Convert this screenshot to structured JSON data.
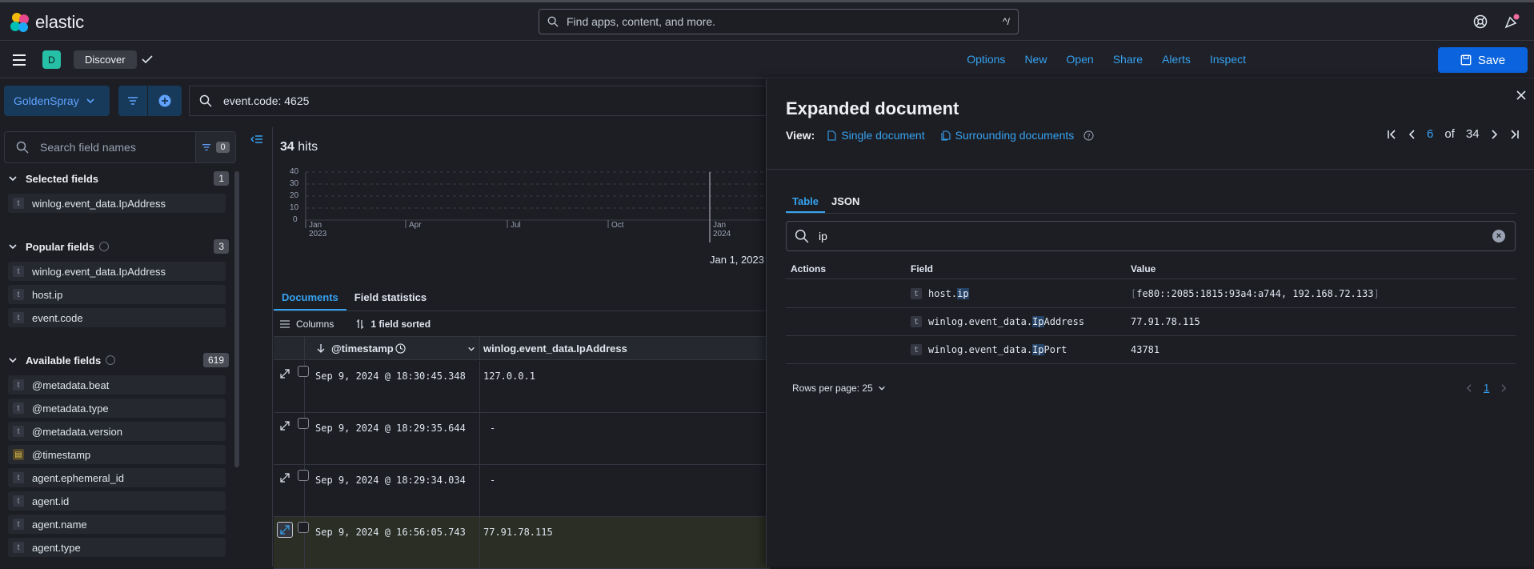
{
  "header": {
    "brand": "elastic",
    "search_placeholder": "Find apps, content, and more.",
    "search_shortcut": "^/",
    "space_initial": "D",
    "breadcrumb": "Discover",
    "links": [
      "Options",
      "New",
      "Open",
      "Share",
      "Alerts",
      "Inspect"
    ],
    "save_label": "Save"
  },
  "query": {
    "data_view": "GoldenSpray",
    "text": "event.code: 4625"
  },
  "sidebar": {
    "search_placeholder": "Search field names",
    "filter_count": "0",
    "selected": {
      "title": "Selected fields",
      "count": "1",
      "fields": [
        {
          "type": "t",
          "name": "winlog.event_data.IpAddress"
        }
      ]
    },
    "popular": {
      "title": "Popular fields",
      "count": "3",
      "fields": [
        {
          "type": "t",
          "name": "winlog.event_data.IpAddress"
        },
        {
          "type": "t",
          "name": "host.ip"
        },
        {
          "type": "t",
          "name": "event.code"
        }
      ]
    },
    "available": {
      "title": "Available fields",
      "count": "619",
      "fields": [
        {
          "type": "t",
          "name": "@metadata.beat"
        },
        {
          "type": "t",
          "name": "@metadata.type"
        },
        {
          "type": "t",
          "name": "@metadata.version"
        },
        {
          "type": "date",
          "name": "@timestamp"
        },
        {
          "type": "t",
          "name": "agent.ephemeral_id"
        },
        {
          "type": "t",
          "name": "agent.id"
        },
        {
          "type": "t",
          "name": "agent.name"
        },
        {
          "type": "t",
          "name": "agent.type"
        }
      ]
    }
  },
  "main": {
    "hits_count": "34",
    "hits_label": "hits",
    "chart_y_ticks": [
      "40",
      "30",
      "20",
      "10",
      "0"
    ],
    "chart_x_ticks": [
      {
        "label": "Jan",
        "sub": "2023"
      },
      {
        "label": "Apr",
        "sub": ""
      },
      {
        "label": "Jul",
        "sub": ""
      },
      {
        "label": "Oct",
        "sub": ""
      },
      {
        "label": "Jan",
        "sub": "2024"
      }
    ],
    "chart_date": "Jan 1, 2023",
    "tabs": [
      "Documents",
      "Field statistics"
    ],
    "columns_label": "Columns",
    "sorted_label": "1 field sorted",
    "col_timestamp": "@timestamp",
    "col_ip": "winlog.event_data.IpAddress",
    "rows": [
      {
        "ts": "Sep 9, 2024 @ 18:30:45.348",
        "ip": "127.0.0.1"
      },
      {
        "ts": "Sep 9, 2024 @ 18:29:35.644",
        "ip": "-"
      },
      {
        "ts": "Sep 9, 2024 @ 18:29:34.034",
        "ip": "-"
      },
      {
        "ts": "Sep 9, 2024 @ 16:56:05.743",
        "ip": "77.91.78.115"
      }
    ]
  },
  "flyout": {
    "title": "Expanded document",
    "view_label": "View:",
    "single_doc": "Single document",
    "surrounding_docs": "Surrounding documents",
    "page_current": "6",
    "page_of": "of",
    "page_total": "34",
    "tabs": [
      "Table",
      "JSON"
    ],
    "search_value": "ip",
    "col_actions": "Actions",
    "col_field": "Field",
    "col_value": "Value",
    "rows": [
      {
        "field_pre": "host.",
        "field_hl": "ip",
        "field_post": "",
        "value": "fe80::2085:1815:93a4:a744, 192.168.72.133",
        "bracketed": true
      },
      {
        "field_pre": "winlog.event_data.",
        "field_hl": "Ip",
        "field_post": "Address",
        "value": "77.91.78.115",
        "bracketed": false
      },
      {
        "field_pre": "winlog.event_data.",
        "field_hl": "Ip",
        "field_post": "Port",
        "value": "43781",
        "bracketed": false
      }
    ],
    "rows_per_page": "Rows per page: 25",
    "page_num": "1"
  },
  "colors": {
    "accent": "#36a2ef",
    "save": "#0b64dd",
    "space_badge": "#25c0a6"
  }
}
